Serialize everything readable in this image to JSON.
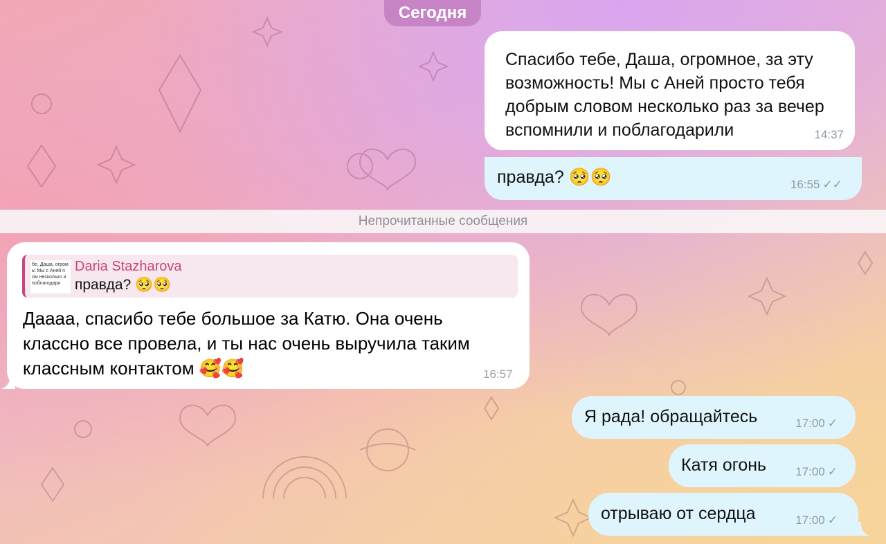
{
  "date_separator": "Сегодня",
  "unread_separator": "Непрочитанные сообщения",
  "messages": [
    {
      "lines": [
        "Спасибо тебе, Даша, огромное, за эту",
        "возможность! Мы с Аней просто тебя",
        "добрым словом несколько раз за вечер",
        "вспомнили и поблагодарили"
      ],
      "time": "14:37"
    },
    {
      "text": "правда? 🥺🥺",
      "time": "16:55",
      "status": "✓✓"
    },
    {
      "reply_name": "Daria Stazharova",
      "reply_text": "правда? 🥺🥺",
      "reply_thumb": "бе, Даша, огром ь! Мы с Аней п ом несколько и поблагодари",
      "lines": [
        "Дааaa, спасибо тебе большое за Катю. Она очень",
        "классно все провела, и ты нас очень выручила таким",
        "классным контактом 🥰🥰"
      ],
      "time": "16:57"
    },
    {
      "text": "Я рада! обращайтесь",
      "time": "17:00",
      "status": "✓"
    },
    {
      "text": "Катя огонь",
      "time": "17:00",
      "status": "✓"
    },
    {
      "text": "отрываю от сердца",
      "time": "17:00",
      "status": "✓"
    }
  ],
  "colors": {
    "accent": "#c8467c",
    "out_bubble": "#dff5fd",
    "in_bubble": "#ffffff"
  }
}
